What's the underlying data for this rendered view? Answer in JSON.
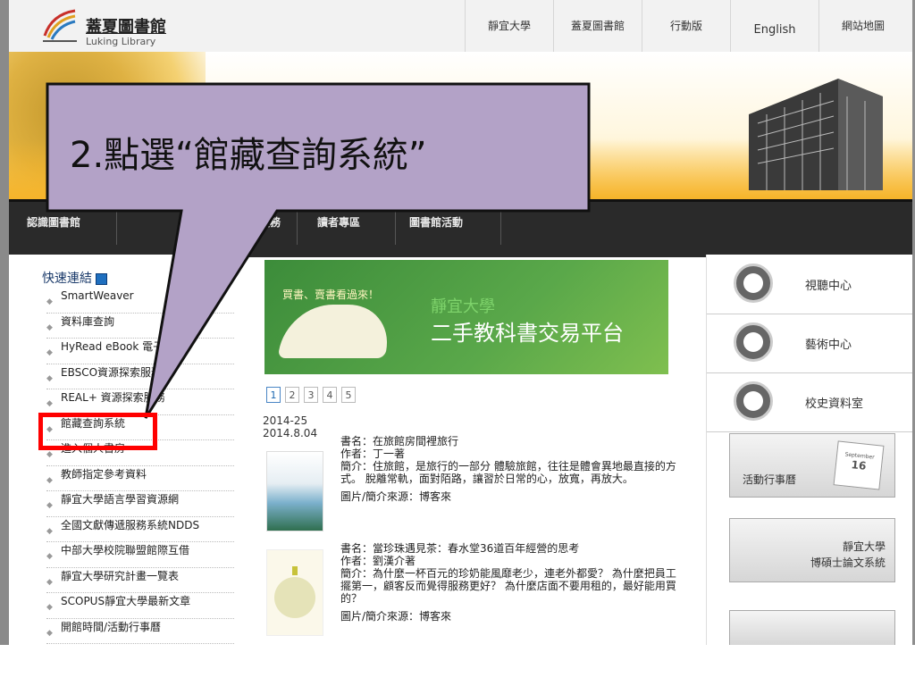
{
  "header": {
    "logo_zh": "蓋夏圖書館",
    "logo_en": "Luking Library",
    "nav": [
      "靜宜大學",
      "蓋夏圖書館",
      "行動版",
      "English",
      "網站地圖"
    ]
  },
  "mainnav": {
    "items": [
      "認識圖書館",
      "服務",
      "讀者專區",
      "圖書館活動"
    ]
  },
  "quick_links": {
    "title": "快速連結",
    "items": [
      "SmartWeaver",
      "資料庫查詢",
      "HyRead eBook 電子書庫",
      "EBSCO資源探索服務",
      "REAL+ 資源探索服務",
      "館藏查詢系統",
      "進入個人書房",
      "教師指定參考資料",
      "靜宜大學語言學習資源網",
      "全國文獻傳遞服務系統NDDS",
      "中部大學校院聯盟館際互借",
      "靜宜大學研究計畫一覽表",
      "SCOPUS靜宜大學最新文章",
      "開館時間/活動行事曆"
    ]
  },
  "slide": {
    "tagline": "買書、賣書看過來！",
    "title_small": "靜宜大學",
    "title_big": "二手教科書交易平台",
    "pages": [
      "1",
      "2",
      "3",
      "4",
      "5"
    ]
  },
  "books": {
    "period_1": "2014-25",
    "period_2": "2014.8.04",
    "items": [
      {
        "title": "書名：在旅館房間裡旅行",
        "author": "作者：丁一著",
        "intro": "簡介：住旅館，是旅行的一部分 體驗旅館，往往是體會異地最直接的方式。 脫離常軌，面對陌路，讓習於日常的心，放寬，再放大。",
        "source": "圖片/簡介來源：博客來"
      },
      {
        "title": "書名：當珍珠遇見茶：春水堂36道百年經營的思考",
        "author": "作者：劉漢介著",
        "intro": "簡介：為什麼一杯百元的珍奶能風靡老少，連老外都愛？ 為什麼把員工擺第一，顧客反而覺得服務更好？ 為什麼店面不要用租的，最好能用買的？",
        "source": "圖片/簡介來源：博客來"
      }
    ]
  },
  "right_links": [
    "視聽中心",
    "藝術中心",
    "校史資料室"
  ],
  "right_banners": {
    "calendar_label": "活動行事曆",
    "calendar_month": "September",
    "calendar_day": "16",
    "thesis_line1": "靜宜大學",
    "thesis_line2": "博碩士論文系統"
  },
  "callout": {
    "text": "2.點選“館藏查詢系統”",
    "fill": "#b3a2c7",
    "highlight": "#ff0000"
  }
}
